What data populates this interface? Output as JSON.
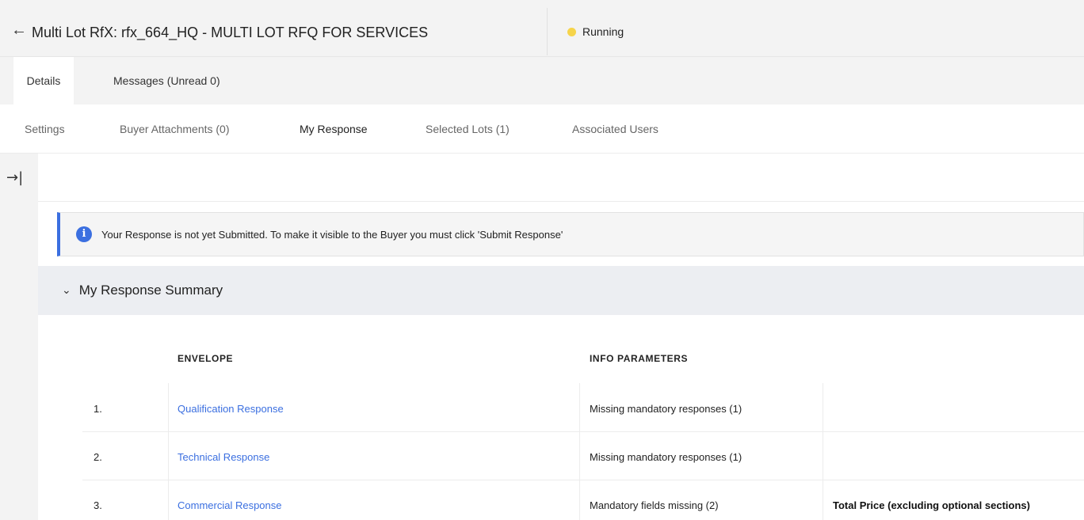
{
  "header": {
    "back_icon": "arrow-left-icon",
    "title": "Multi Lot RfX: rfx_664_HQ - MULTI LOT RFQ FOR SERVICES",
    "status": {
      "label": "Running",
      "color": "#f6d44a"
    }
  },
  "primary_tabs": [
    {
      "label": "Details",
      "active": true
    },
    {
      "label": "Messages (Unread 0)",
      "active": false
    }
  ],
  "secondary_tabs": [
    {
      "label": "Settings",
      "active": false
    },
    {
      "label": "Buyer Attachments (0)",
      "active": false
    },
    {
      "label": "My Response",
      "active": true
    },
    {
      "label": "Selected Lots (1)",
      "active": false
    },
    {
      "label": "Associated Users",
      "active": false
    }
  ],
  "rail": {
    "collapse_icon": "arrow-to-right-icon"
  },
  "banner": {
    "icon": "info-icon",
    "text": "Your Response is not yet Submitted. To make it visible to the Buyer you must click 'Submit Response'",
    "accent": "#3b6fe0"
  },
  "summary": {
    "title": "My Response Summary",
    "expanded": true,
    "columns": {
      "envelope": "ENVELOPE",
      "info": "INFO PARAMETERS"
    },
    "rows": [
      {
        "num": "1.",
        "envelope": "Qualification Response",
        "info": "Missing mandatory responses (1)",
        "extra": ""
      },
      {
        "num": "2.",
        "envelope": "Technical Response",
        "info": "Missing mandatory responses (1)",
        "extra": ""
      },
      {
        "num": "3.",
        "envelope": "Commercial Response",
        "info": "Mandatory fields missing (2)",
        "extra": "Total Price (excluding optional sections)"
      }
    ]
  }
}
